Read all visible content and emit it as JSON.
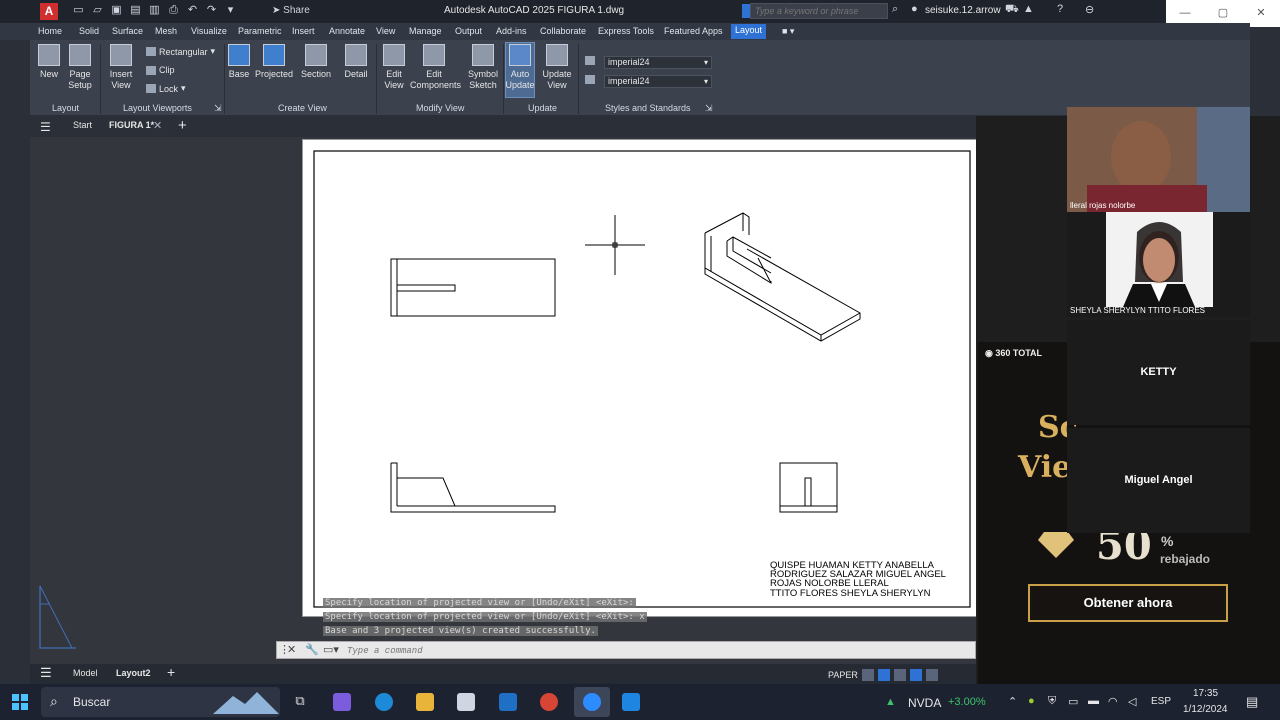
{
  "titlebar": {
    "app_logo": "A",
    "share_label": "Share",
    "window_title": "Autodesk AutoCAD 2025   FIGURA 1.dwg",
    "search_placeholder": "Type a keyword or phrase",
    "user_name": "seisuke.12.arrow"
  },
  "ribbon_tabs": [
    "Home",
    "Solid",
    "Surface",
    "Mesh",
    "Visualize",
    "Parametric",
    "Insert",
    "Annotate",
    "View",
    "Manage",
    "Output",
    "Add-ins",
    "Collaborate",
    "Express Tools",
    "Featured Apps",
    "Layout"
  ],
  "ribbon": {
    "layout_group": {
      "label": "Layout",
      "new": "New",
      "page_setup": "Page Setup"
    },
    "viewports_group": {
      "label": "Layout Viewports",
      "insert_view": "Insert View",
      "rectangular": "Rectangular",
      "clip": "Clip",
      "lock": "Lock"
    },
    "create_view_group": {
      "label": "Create View",
      "base": "Base",
      "projected": "Projected",
      "section": "Section",
      "detail": "Detail"
    },
    "modify_view_group": {
      "label": "Modify View",
      "edit_view": "Edit View",
      "edit_components": "Edit Components",
      "symbol_sketch": "Symbol Sketch"
    },
    "update_group": {
      "label": "Update",
      "auto_update": "Auto Update",
      "update_view": "Update View"
    },
    "styles_group": {
      "label": "Styles and Standards",
      "style1": "imperial24",
      "style2": "imperial24"
    }
  },
  "file_tabs": {
    "start": "Start",
    "active": "FIGURA 1*"
  },
  "drawing": {
    "title_block": [
      "QUISPE HUAMAN KETTY ANABELLA",
      "RODRIGUEZ SALAZAR MIGUEL ANGEL",
      "ROJAS NOLORBE LLERAL",
      "TTITO FLORES SHEYLA SHERYLYN"
    ]
  },
  "command": {
    "history": [
      "Specify location of projected view or [Undo/eXit] <eXit>:",
      "Specify location of projected view or [Undo/eXit] <eXit>: x",
      "Base and 3 projected view(s) created successfully."
    ],
    "placeholder": "Type a command"
  },
  "layout_tabs": {
    "model": "Model",
    "layout2": "Layout2"
  },
  "status": {
    "space": "PAPER"
  },
  "meeting": {
    "video1_label": "lleral rojas nolorbe",
    "video2_label": "SHEYLA SHERYLYN TTITO FLORES",
    "participant1": "KETTY",
    "participant2": "Miguel Angel"
  },
  "ad": {
    "brand": "360 TOTAL",
    "headline1": "Sc",
    "headline2": "Vie",
    "percent": "50",
    "percent_sign": "%",
    "discount": "rebajado",
    "button": "Obtener ahora"
  },
  "taskbar": {
    "search_label": "Buscar",
    "stock_name": "NVDA",
    "stock_change": "+3.00%",
    "lang": "ESP",
    "time": "17:35",
    "date": "1/12/2024"
  },
  "colors": {
    "accent": "#2f72d6",
    "stock_up": "#3cc36b",
    "ad_gold": "#c9a047"
  }
}
